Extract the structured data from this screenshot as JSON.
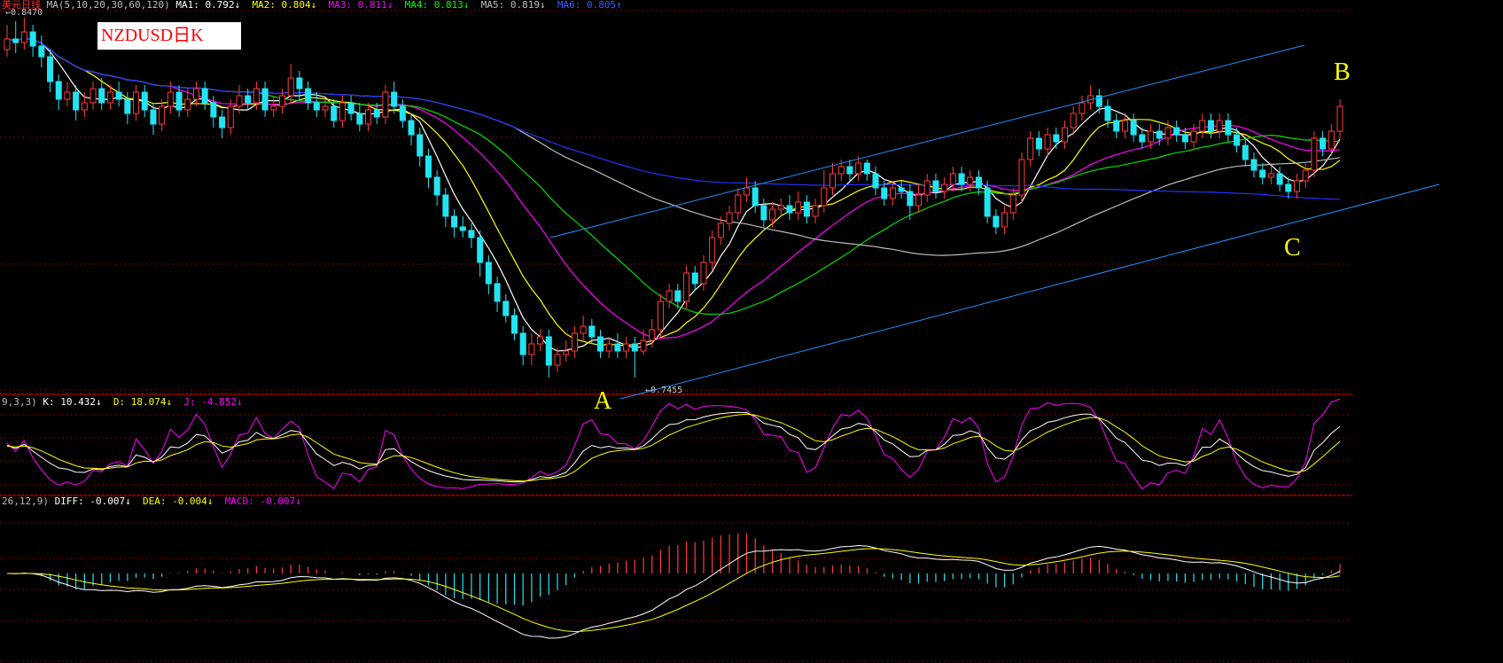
{
  "header": {
    "ma_line": {
      "prefix": "美元日线",
      "params": "MA(5,10,20,30,60,120)",
      "ma1": "MA1: 0.792↓",
      "ma2": "MA2: 0.804↓",
      "ma3": "MA3: 0.811↓",
      "ma4": "MA4: 0.813↓",
      "ma5": "MA5: 0.819↓",
      "ma6": "MA6: 0.805↑"
    },
    "high_label": "0.8470",
    "low_label": "0.7455"
  },
  "title_box": "NZDUSD日K",
  "annotations": {
    "a": "A",
    "b": "B",
    "c": "C"
  },
  "kdj": {
    "params": "9,3,3)",
    "k": "K: 10.432↓",
    "d": "D: 18.074↓",
    "j": "J: -4.852↓"
  },
  "macd": {
    "params": "26,12,9)",
    "diff": "DIFF: -0.007↓",
    "dea": "DEA: -0.004↓",
    "macd": "MACD: -0.007↓"
  },
  "colors": {
    "bull": "#ff3b3b",
    "bear": "#22e3f2",
    "ma5": "#ffffff",
    "ma10": "#ffff00",
    "ma20": "#ff00ff",
    "ma30": "#00dd00",
    "ma60": "#bdbdbd",
    "ma120": "#2233ff",
    "channel": "#1e90ff",
    "grid": "#7a0000"
  },
  "chart_data": {
    "type": "candlestick",
    "instrument": "NZDUSD",
    "period": "daily",
    "price_high": 0.847,
    "price_low": 0.7455,
    "candles": [
      [
        0.838,
        0.841,
        0.836,
        0.845
      ],
      [
        0.841,
        0.84,
        0.837,
        0.846
      ],
      [
        0.84,
        0.843,
        0.838,
        0.847
      ],
      [
        0.843,
        0.839,
        0.836,
        0.845
      ],
      [
        0.839,
        0.836,
        0.833,
        0.842
      ],
      [
        0.836,
        0.829,
        0.826,
        0.838
      ],
      [
        0.829,
        0.824,
        0.821,
        0.831
      ],
      [
        0.824,
        0.826,
        0.822,
        0.829
      ],
      [
        0.826,
        0.821,
        0.818,
        0.828
      ],
      [
        0.821,
        0.823,
        0.819,
        0.826
      ],
      [
        0.823,
        0.827,
        0.821,
        0.829
      ],
      [
        0.827,
        0.823,
        0.821,
        0.83
      ],
      [
        0.823,
        0.826,
        0.821,
        0.828
      ],
      [
        0.826,
        0.824,
        0.822,
        0.829
      ],
      [
        0.824,
        0.82,
        0.817,
        0.826
      ],
      [
        0.82,
        0.826,
        0.818,
        0.828
      ],
      [
        0.826,
        0.821,
        0.819,
        0.828
      ],
      [
        0.821,
        0.817,
        0.814,
        0.823
      ],
      [
        0.817,
        0.822,
        0.815,
        0.824
      ],
      [
        0.822,
        0.826,
        0.82,
        0.829
      ],
      [
        0.826,
        0.821,
        0.819,
        0.828
      ],
      [
        0.821,
        0.824,
        0.819,
        0.827
      ],
      [
        0.824,
        0.827,
        0.822,
        0.829
      ],
      [
        0.827,
        0.823,
        0.821,
        0.829
      ],
      [
        0.823,
        0.819,
        0.816,
        0.825
      ],
      [
        0.819,
        0.816,
        0.813,
        0.821
      ],
      [
        0.816,
        0.822,
        0.814,
        0.824
      ],
      [
        0.822,
        0.825,
        0.82,
        0.828
      ],
      [
        0.825,
        0.823,
        0.821,
        0.827
      ],
      [
        0.823,
        0.827,
        0.821,
        0.829
      ],
      [
        0.827,
        0.821,
        0.819,
        0.829
      ],
      [
        0.821,
        0.822,
        0.819,
        0.825
      ],
      [
        0.822,
        0.825,
        0.82,
        0.827
      ],
      [
        0.825,
        0.83,
        0.823,
        0.834
      ],
      [
        0.83,
        0.827,
        0.824,
        0.832
      ],
      [
        0.827,
        0.823,
        0.821,
        0.829
      ],
      [
        0.823,
        0.821,
        0.819,
        0.826
      ],
      [
        0.821,
        0.822,
        0.819,
        0.824
      ],
      [
        0.822,
        0.818,
        0.816,
        0.824
      ],
      [
        0.818,
        0.823,
        0.816,
        0.825
      ],
      [
        0.823,
        0.82,
        0.818,
        0.825
      ],
      [
        0.82,
        0.817,
        0.815,
        0.823
      ],
      [
        0.817,
        0.821,
        0.815,
        0.823
      ],
      [
        0.821,
        0.819,
        0.817,
        0.823
      ],
      [
        0.819,
        0.826,
        0.817,
        0.828
      ],
      [
        0.826,
        0.822,
        0.82,
        0.829
      ],
      [
        0.822,
        0.818,
        0.816,
        0.824
      ],
      [
        0.818,
        0.814,
        0.811,
        0.82
      ],
      [
        0.814,
        0.808,
        0.805,
        0.816
      ],
      [
        0.808,
        0.802,
        0.799,
        0.81
      ],
      [
        0.802,
        0.797,
        0.794,
        0.804
      ],
      [
        0.797,
        0.791,
        0.788,
        0.799
      ],
      [
        0.791,
        0.788,
        0.785,
        0.793
      ],
      [
        0.788,
        0.787,
        0.785,
        0.791
      ],
      [
        0.787,
        0.785,
        0.782,
        0.789
      ],
      [
        0.785,
        0.778,
        0.774,
        0.787
      ],
      [
        0.778,
        0.772,
        0.769,
        0.78
      ],
      [
        0.772,
        0.767,
        0.764,
        0.774
      ],
      [
        0.767,
        0.763,
        0.761,
        0.769
      ],
      [
        0.763,
        0.758,
        0.756,
        0.765
      ],
      [
        0.758,
        0.752,
        0.749,
        0.76
      ],
      [
        0.752,
        0.755,
        0.749,
        0.758
      ],
      [
        0.755,
        0.757,
        0.753,
        0.759
      ],
      [
        0.757,
        0.749,
        0.7455,
        0.759
      ],
      [
        0.749,
        0.752,
        0.747,
        0.754
      ],
      [
        0.752,
        0.753,
        0.75,
        0.756
      ],
      [
        0.753,
        0.758,
        0.751,
        0.76
      ],
      [
        0.758,
        0.76,
        0.756,
        0.763
      ],
      [
        0.76,
        0.757,
        0.755,
        0.762
      ],
      [
        0.757,
        0.753,
        0.751,
        0.759
      ],
      [
        0.753,
        0.755,
        0.751,
        0.757
      ],
      [
        0.755,
        0.753,
        0.751,
        0.758
      ],
      [
        0.753,
        0.755,
        0.751,
        0.757
      ],
      [
        0.755,
        0.753,
        0.7455,
        0.757
      ],
      [
        0.753,
        0.756,
        0.752,
        0.759
      ],
      [
        0.756,
        0.759,
        0.754,
        0.762
      ],
      [
        0.759,
        0.767,
        0.757,
        0.769
      ],
      [
        0.767,
        0.77,
        0.765,
        0.772
      ],
      [
        0.77,
        0.767,
        0.765,
        0.772
      ],
      [
        0.767,
        0.775,
        0.765,
        0.777
      ],
      [
        0.775,
        0.772,
        0.77,
        0.777
      ],
      [
        0.772,
        0.778,
        0.77,
        0.78
      ],
      [
        0.778,
        0.785,
        0.776,
        0.787
      ],
      [
        0.785,
        0.789,
        0.783,
        0.791
      ],
      [
        0.789,
        0.792,
        0.787,
        0.794
      ],
      [
        0.792,
        0.797,
        0.79,
        0.799
      ],
      [
        0.797,
        0.799,
        0.795,
        0.802
      ],
      [
        0.799,
        0.794,
        0.792,
        0.801
      ],
      [
        0.794,
        0.79,
        0.788,
        0.796
      ],
      [
        0.79,
        0.793,
        0.788,
        0.795
      ],
      [
        0.793,
        0.794,
        0.791,
        0.796
      ],
      [
        0.794,
        0.792,
        0.79,
        0.797
      ],
      [
        0.792,
        0.795,
        0.79,
        0.798
      ],
      [
        0.795,
        0.791,
        0.789,
        0.797
      ],
      [
        0.791,
        0.794,
        0.789,
        0.796
      ],
      [
        0.794,
        0.799,
        0.792,
        0.804
      ],
      [
        0.799,
        0.803,
        0.797,
        0.806
      ],
      [
        0.803,
        0.805,
        0.801,
        0.807
      ],
      [
        0.805,
        0.803,
        0.801,
        0.807
      ],
      [
        0.803,
        0.806,
        0.801,
        0.808
      ],
      [
        0.806,
        0.803,
        0.801,
        0.807
      ],
      [
        0.803,
        0.799,
        0.797,
        0.805
      ],
      [
        0.799,
        0.796,
        0.794,
        0.801
      ],
      [
        0.796,
        0.799,
        0.794,
        0.801
      ],
      [
        0.799,
        0.798,
        0.796,
        0.801
      ],
      [
        0.798,
        0.794,
        0.79,
        0.8
      ],
      [
        0.794,
        0.797,
        0.792,
        0.8
      ],
      [
        0.797,
        0.801,
        0.795,
        0.803
      ],
      [
        0.801,
        0.798,
        0.796,
        0.803
      ],
      [
        0.798,
        0.8,
        0.796,
        0.802
      ],
      [
        0.8,
        0.803,
        0.798,
        0.805
      ],
      [
        0.803,
        0.8,
        0.798,
        0.805
      ],
      [
        0.8,
        0.802,
        0.798,
        0.804
      ],
      [
        0.802,
        0.799,
        0.797,
        0.804
      ],
      [
        0.799,
        0.791,
        0.789,
        0.801
      ],
      [
        0.791,
        0.788,
        0.786,
        0.793
      ],
      [
        0.788,
        0.792,
        0.786,
        0.794
      ],
      [
        0.792,
        0.797,
        0.79,
        0.799
      ],
      [
        0.797,
        0.807,
        0.795,
        0.809
      ],
      [
        0.807,
        0.813,
        0.805,
        0.815
      ],
      [
        0.813,
        0.81,
        0.808,
        0.815
      ],
      [
        0.81,
        0.814,
        0.808,
        0.816
      ],
      [
        0.814,
        0.812,
        0.81,
        0.816
      ],
      [
        0.812,
        0.816,
        0.81,
        0.818
      ],
      [
        0.816,
        0.82,
        0.814,
        0.822
      ],
      [
        0.82,
        0.823,
        0.818,
        0.825
      ],
      [
        0.823,
        0.825,
        0.821,
        0.828
      ],
      [
        0.825,
        0.822,
        0.82,
        0.827
      ],
      [
        0.822,
        0.818,
        0.816,
        0.824
      ],
      [
        0.818,
        0.815,
        0.813,
        0.82
      ],
      [
        0.815,
        0.818,
        0.813,
        0.82
      ],
      [
        0.818,
        0.814,
        0.812,
        0.82
      ],
      [
        0.814,
        0.812,
        0.81,
        0.816
      ],
      [
        0.812,
        0.815,
        0.81,
        0.817
      ],
      [
        0.815,
        0.813,
        0.811,
        0.817
      ],
      [
        0.813,
        0.816,
        0.811,
        0.818
      ],
      [
        0.816,
        0.814,
        0.812,
        0.818
      ],
      [
        0.814,
        0.812,
        0.81,
        0.816
      ],
      [
        0.812,
        0.815,
        0.81,
        0.817
      ],
      [
        0.815,
        0.818,
        0.813,
        0.82
      ],
      [
        0.818,
        0.815,
        0.813,
        0.82
      ],
      [
        0.815,
        0.818,
        0.813,
        0.82
      ],
      [
        0.818,
        0.814,
        0.812,
        0.82
      ],
      [
        0.814,
        0.811,
        0.809,
        0.816
      ],
      [
        0.811,
        0.807,
        0.805,
        0.813
      ],
      [
        0.807,
        0.804,
        0.802,
        0.809
      ],
      [
        0.804,
        0.802,
        0.8,
        0.806
      ],
      [
        0.802,
        0.803,
        0.8,
        0.805
      ],
      [
        0.803,
        0.8,
        0.798,
        0.805
      ],
      [
        0.8,
        0.798,
        0.796,
        0.802
      ],
      [
        0.798,
        0.801,
        0.796,
        0.803
      ],
      [
        0.801,
        0.804,
        0.799,
        0.806
      ],
      [
        0.804,
        0.813,
        0.802,
        0.815
      ],
      [
        0.813,
        0.81,
        0.808,
        0.815
      ],
      [
        0.81,
        0.815,
        0.808,
        0.817
      ],
      [
        0.815,
        0.822,
        0.813,
        0.824
      ]
    ],
    "channel_lines": [
      "upper trendline",
      "lower trendline"
    ],
    "points": [
      "A",
      "B",
      "C"
    ],
    "indicators": [
      "KDJ(9,3,3)",
      "MACD(26,12,9)"
    ]
  }
}
